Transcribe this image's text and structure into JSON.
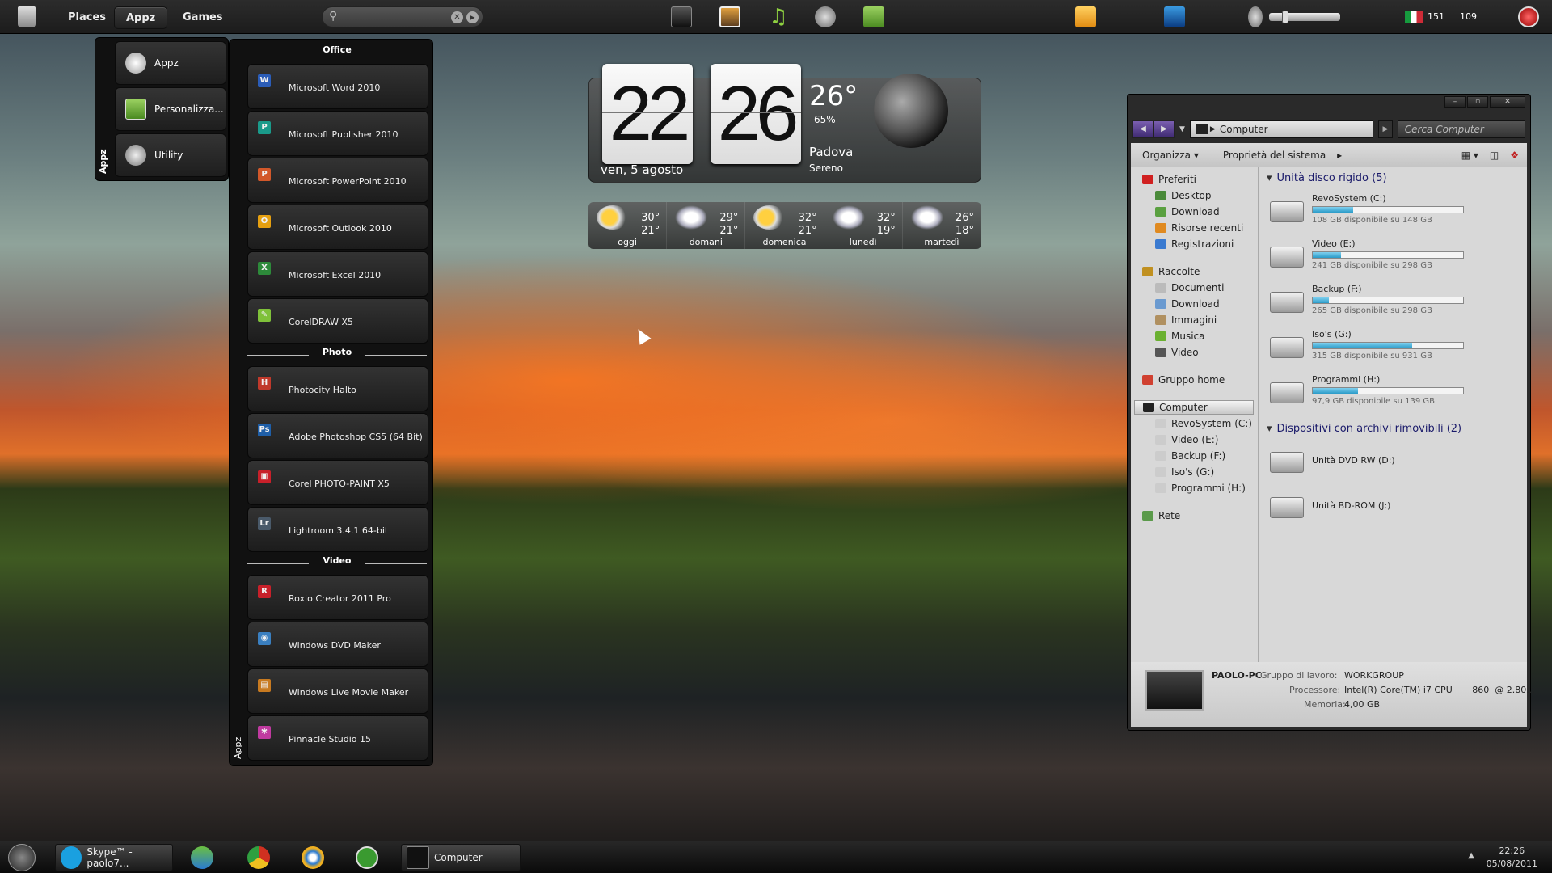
{
  "topbar": {
    "trash_icon": "recycle-bin-icon",
    "nav": [
      {
        "label": "Places",
        "active": false
      },
      {
        "label": "Appz",
        "active": true
      },
      {
        "label": "Games",
        "active": false
      }
    ],
    "search": {
      "value": "",
      "placeholder": ""
    },
    "launchers": [
      "monitor-icon",
      "pictures-icon",
      "music-note-icon",
      "video-reel-icon",
      "download-folder-icon"
    ],
    "right_icons": [
      "outlook-icon",
      "desktop-preview-icon",
      "volume-icon"
    ],
    "status_value": "151",
    "status_value2": "109",
    "volume": 0.1
  },
  "menu_left": {
    "vertical_label": "Appz",
    "items": [
      {
        "label": "Appz",
        "icon": "appz-disc-icon"
      },
      {
        "label": "Personalizza...",
        "icon": "personalize-icon"
      },
      {
        "label": "Utility",
        "icon": "gears-icon"
      }
    ]
  },
  "menu_apps": {
    "vertical_label": "Appz",
    "sections": [
      {
        "title": "Office",
        "apps": [
          {
            "label": "Microsoft Word 2010",
            "glyph": "W",
            "color": "#2b5db8"
          },
          {
            "label": "Microsoft Publisher 2010",
            "glyph": "P",
            "color": "#1a9a8a"
          },
          {
            "label": "Microsoft PowerPoint 2010",
            "glyph": "P",
            "color": "#d2582a"
          },
          {
            "label": "Microsoft Outlook 2010",
            "glyph": "O",
            "color": "#e6a010"
          },
          {
            "label": "Microsoft Excel 2010",
            "glyph": "X",
            "color": "#2d8a3a"
          },
          {
            "label": "CorelDRAW X5",
            "glyph": "✎",
            "color": "#7fc13a"
          }
        ]
      },
      {
        "title": "Photo",
        "apps": [
          {
            "label": "Photocity Halto",
            "glyph": "H",
            "color": "#c0392b"
          },
          {
            "label": "Adobe Photoshop CS5 (64 Bit)",
            "glyph": "Ps",
            "color": "#1f5fa8"
          },
          {
            "label": "Corel PHOTO-PAINT X5",
            "glyph": "▣",
            "color": "#c8202a"
          },
          {
            "label": "Lightroom 3.4.1 64-bit",
            "glyph": "Lr",
            "color": "#4a5a6a"
          }
        ]
      },
      {
        "title": "Video",
        "apps": [
          {
            "label": "Roxio Creator 2011 Pro",
            "glyph": "R",
            "color": "#c8202a"
          },
          {
            "label": "Windows DVD Maker",
            "glyph": "◉",
            "color": "#3a7fc0"
          },
          {
            "label": "Windows Live Movie Maker",
            "glyph": "▤",
            "color": "#c87a20"
          },
          {
            "label": "Pinnacle Studio 15",
            "glyph": "✱",
            "color": "#c03aa0"
          }
        ]
      }
    ]
  },
  "clock_widget": {
    "hour": "22",
    "minute": "26",
    "date": "ven, 5 agosto",
    "temperature": "26°",
    "humidity": "65%",
    "city": "Padova",
    "condition": "Sereno",
    "moon_icon": "moon-icon"
  },
  "forecast": [
    {
      "day": "oggi",
      "high": "30°",
      "low": "21°",
      "icon": "partly-sunny-icon"
    },
    {
      "day": "domani",
      "high": "29°",
      "low": "21°",
      "icon": "rain-cloud-icon"
    },
    {
      "day": "domenica",
      "high": "32°",
      "low": "21°",
      "icon": "partly-sunny-icon"
    },
    {
      "day": "lunedì",
      "high": "32°",
      "low": "19°",
      "icon": "rain-cloud-icon"
    },
    {
      "day": "martedì",
      "high": "26°",
      "low": "18°",
      "icon": "rain-cloud-icon"
    }
  ],
  "explorer": {
    "window_buttons": [
      "–",
      "▫",
      "✕"
    ],
    "address": "Computer",
    "search_placeholder": "Cerca Computer",
    "commands": [
      "Organizza ▾",
      "Proprietà del sistema",
      "▸"
    ],
    "nav": [
      {
        "label": "Preferiti",
        "sub": false,
        "color": "#d02020"
      },
      {
        "label": "Desktop",
        "sub": true,
        "color": "#4a8a3a"
      },
      {
        "label": "Download",
        "sub": true,
        "color": "#5aa040"
      },
      {
        "label": "Risorse recenti",
        "sub": true,
        "color": "#e08a20"
      },
      {
        "label": "Registrazioni",
        "sub": true,
        "color": "#3a7ad0"
      },
      {
        "label": "Raccolte",
        "sub": false,
        "color": "#c09020"
      },
      {
        "label": "Documenti",
        "sub": true,
        "color": "#bbbbbb"
      },
      {
        "label": "Download",
        "sub": true,
        "color": "#6a9ad0"
      },
      {
        "label": "Immagini",
        "sub": true,
        "color": "#b09060"
      },
      {
        "label": "Musica",
        "sub": true,
        "color": "#6ab030"
      },
      {
        "label": "Video",
        "sub": true,
        "color": "#555555"
      },
      {
        "label": "Gruppo home",
        "sub": false,
        "color": "#d04030"
      },
      {
        "label": "Computer",
        "sub": false,
        "color": "#222222",
        "selected": true
      },
      {
        "label": "RevoSystem (C:)",
        "sub": true,
        "color": "#cccccc"
      },
      {
        "label": "Video (E:)",
        "sub": true,
        "color": "#cccccc"
      },
      {
        "label": "Backup (F:)",
        "sub": true,
        "color": "#cccccc"
      },
      {
        "label": "Iso's (G:)",
        "sub": true,
        "color": "#cccccc"
      },
      {
        "label": "Programmi (H:)",
        "sub": true,
        "color": "#cccccc"
      },
      {
        "label": "Rete",
        "sub": false,
        "color": "#5a9a4a"
      }
    ],
    "groups": [
      {
        "title": "Unità disco rigido (5)",
        "drives": [
          {
            "name": "RevoSystem (C:)",
            "free": "108 GB disponibile su 148 GB",
            "used_fraction": 0.27
          },
          {
            "name": "Video (E:)",
            "free": "241 GB disponibile su 298 GB",
            "used_fraction": 0.19
          },
          {
            "name": "Backup (F:)",
            "free": "265 GB disponibile su 298 GB",
            "used_fraction": 0.11
          },
          {
            "name": "Iso's (G:)",
            "free": "315 GB disponibile su 931 GB",
            "used_fraction": 0.66
          },
          {
            "name": "Programmi (H:)",
            "free": "97,9 GB disponibile su 139 GB",
            "used_fraction": 0.3
          }
        ]
      },
      {
        "title": "Dispositivi con archivi rimovibili (2)",
        "drives": [
          {
            "name": "Unità DVD RW (D:)"
          },
          {
            "name": "Unità BD-ROM (J:)"
          }
        ]
      }
    ],
    "details": {
      "pc_name": "PAOLO-PC",
      "workgroup_label": "Gruppo di lavoro:",
      "workgroup": "WORKGROUP",
      "cpu_label": "Processore:",
      "cpu": "Intel(R) Core(TM) i7 CPU       860  @ 2.80...",
      "mem_label": "Memoria:",
      "mem": "4,00 GB"
    }
  },
  "taskbar": {
    "start_icon": "windows-orb-icon",
    "items": [
      {
        "label": "Skype™ - paolo7...",
        "icon": "skype-icon",
        "window": true
      },
      {
        "label": "",
        "icon": "messenger-icon",
        "window": false
      },
      {
        "label": "",
        "icon": "chrome-icon",
        "window": false
      },
      {
        "label": "",
        "icon": "internet-explorer-icon",
        "window": false
      },
      {
        "label": "",
        "icon": "utorrent-icon",
        "window": false
      },
      {
        "label": "Computer",
        "icon": "computer-icon",
        "window": true
      }
    ],
    "time": "22:26",
    "date": "05/08/2011"
  }
}
